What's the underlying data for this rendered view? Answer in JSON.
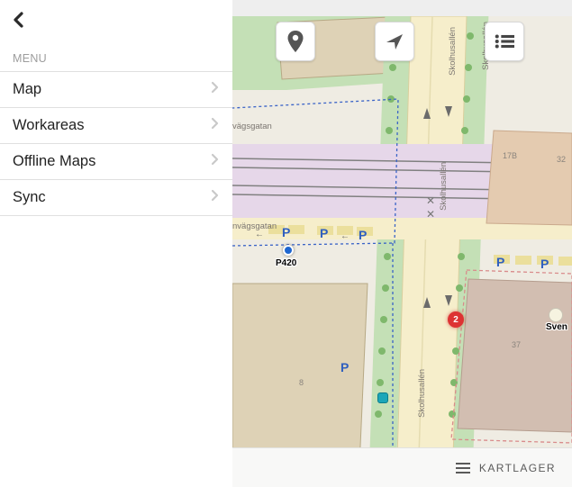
{
  "sidebar": {
    "header": "MENU",
    "items": [
      {
        "label": "Map"
      },
      {
        "label": "Workareas"
      },
      {
        "label": "Offline Maps"
      },
      {
        "label": "Sync"
      }
    ]
  },
  "map_controls": {
    "pin_icon": "location-pin",
    "locate_icon": "navigation-arrow",
    "layers_icon": "list-lines"
  },
  "bottom_bar": {
    "label": "KARTLAGER",
    "icon": "hamburger"
  },
  "map": {
    "streets": {
      "skolhusallen": "Skolhusallén",
      "vagsgatan_fragment": "vägsgatan",
      "nvagsgatan_fragment": "nvägsgatan"
    },
    "parking_symbol": "P",
    "markers": {
      "p420_label": "P420",
      "red_cluster_count": "2",
      "sven_label": "Sven"
    },
    "house_numbers": {
      "n8": "8",
      "n32": "32",
      "n37": "37",
      "n17b": "17B"
    }
  }
}
